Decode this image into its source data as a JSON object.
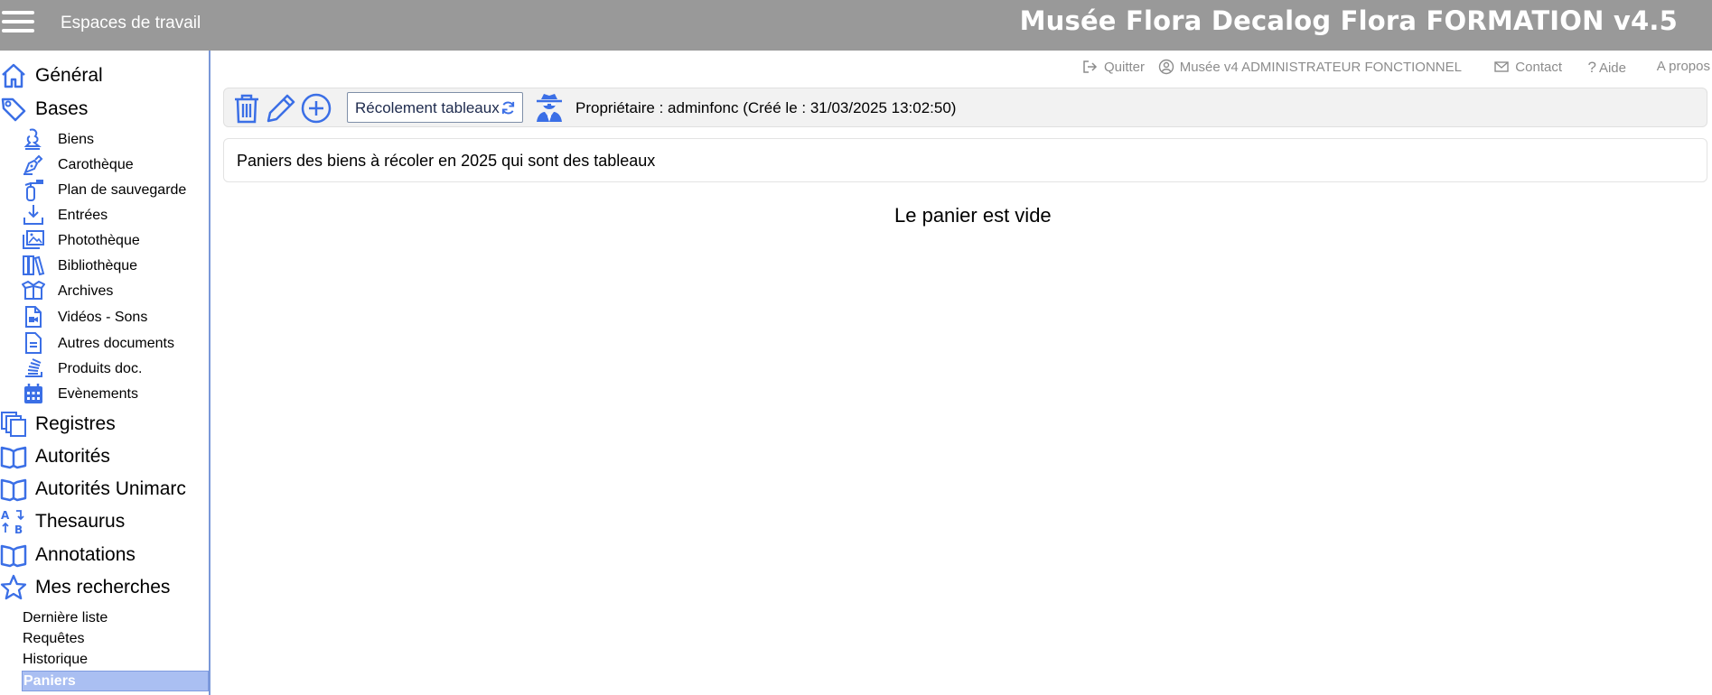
{
  "header": {
    "workspaces_label": "Espaces de travail",
    "app_title": "Musée Flora Decalog Flora FORMATION v4.5"
  },
  "top_links": {
    "quit": "Quitter",
    "user": "Musée v4 ADMINISTRATEUR FONCTIONNEL",
    "contact": "Contact",
    "help": "Aide",
    "about": "A propos"
  },
  "sidebar": {
    "general": "Général",
    "bases": "Bases",
    "bases_items": [
      "Biens",
      "Carothèque",
      "Plan de sauvegarde",
      "Entrées",
      "Photothèque",
      "Bibliothèque",
      "Archives",
      "Vidéos - Sons",
      "Autres documents",
      "Produits doc.",
      "Evènements"
    ],
    "registres": "Registres",
    "autorites": "Autorités",
    "autorites_unimarc": "Autorités Unimarc",
    "thesaurus": "Thesaurus",
    "annotations": "Annotations",
    "mes_recherches": "Mes recherches",
    "recherches_items": [
      "Dernière liste",
      "Requêtes",
      "Historique",
      "Paniers"
    ],
    "active_item": "Paniers"
  },
  "toolbar": {
    "basket_name": "Récolement tableaux",
    "owner_text": "Propriétaire : adminfonc (Créé le : 31/03/2025 13:02:50)"
  },
  "basket": {
    "description": "Paniers des biens à récoler en 2025 qui sont des tableaux",
    "empty_message": "Le panier est vide"
  },
  "colors": {
    "header_bg": "#999999",
    "accent_blue": "#3b6fe6",
    "active_bg": "#aabff2"
  }
}
